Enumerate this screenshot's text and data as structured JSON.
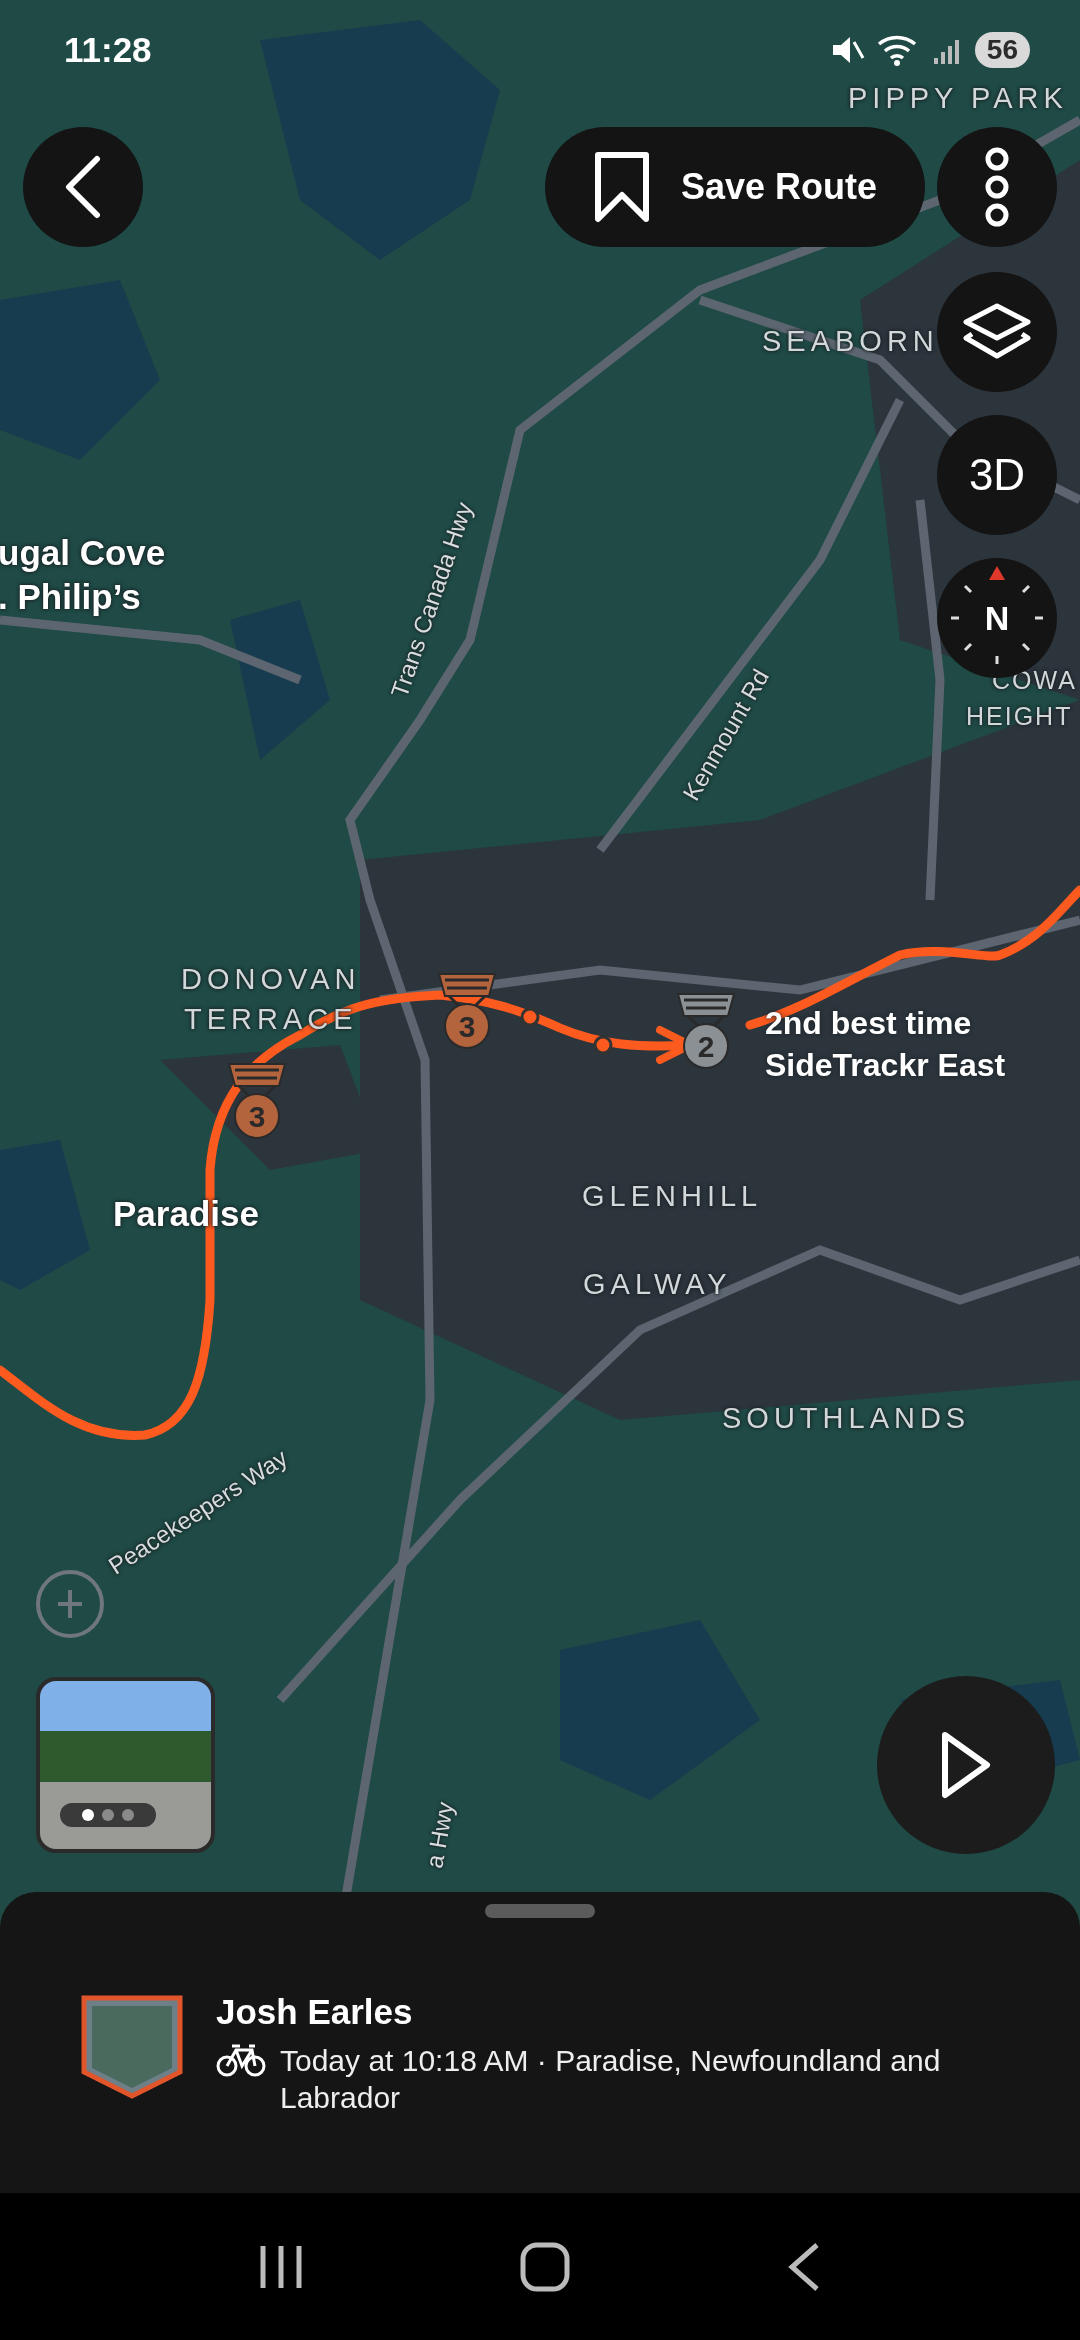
{
  "status_bar": {
    "time": "11:28",
    "battery": "56"
  },
  "toolbar": {
    "save_route": "Save Route"
  },
  "map_controls": {
    "view_3d": "3D",
    "compass": "N"
  },
  "map_labels": [
    {
      "kind": "district",
      "text": "PIPPY PARK"
    },
    {
      "kind": "district",
      "text": "SEABORN"
    },
    {
      "kind": "town",
      "text": "ugal Cove"
    },
    {
      "kind": "town",
      "text": ". Philip’s"
    },
    {
      "kind": "road",
      "text": "Trans Canada Hwy"
    },
    {
      "kind": "road",
      "text": "Kenmount Rd"
    },
    {
      "kind": "district",
      "text": "COWA"
    },
    {
      "kind": "district",
      "text": "HEIGHT"
    },
    {
      "kind": "district",
      "text": "DONOVAN"
    },
    {
      "kind": "district",
      "text": "TERRACE"
    },
    {
      "kind": "town",
      "text": "Paradise"
    },
    {
      "kind": "district",
      "text": "GLENHILL"
    },
    {
      "kind": "district",
      "text": "GALWAY"
    },
    {
      "kind": "district",
      "text": "SOUTHLANDS"
    },
    {
      "kind": "road",
      "text": "Peacekeepers Way"
    },
    {
      "kind": "road",
      "text": "a Hwy"
    }
  ],
  "segment_medals": [
    {
      "rank": "3",
      "color": "#b4643d"
    },
    {
      "rank": "3",
      "color": "#b4643d"
    },
    {
      "rank": "2",
      "color": "#8b9094"
    }
  ],
  "segment_callout": {
    "title": "2nd best time",
    "segment": "SideTrackr East"
  },
  "photo_pages": [
    {
      "selected": true
    },
    {
      "selected": false
    },
    {
      "selected": false
    }
  ],
  "activity": {
    "athlete": "Josh Earles",
    "details": "Today at 10:18 AM · Paradise, Newfoundland and Labrador"
  }
}
